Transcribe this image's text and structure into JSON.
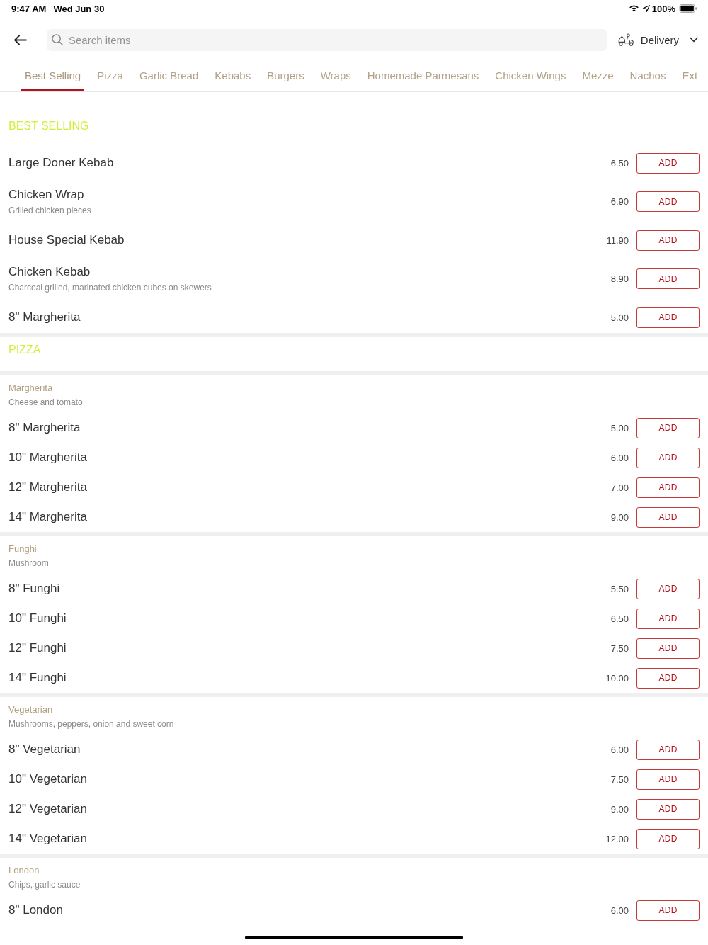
{
  "status_bar": {
    "time": "9:47 AM",
    "date": "Wed Jun 30",
    "battery": "100%"
  },
  "header": {
    "search": {
      "placeholder": "Search items"
    },
    "order_mode": {
      "label": "Delivery"
    }
  },
  "tabs": [
    {
      "label": "Best Selling",
      "selected": true
    },
    {
      "label": "Pizza",
      "selected": false
    },
    {
      "label": "Garlic Bread",
      "selected": false
    },
    {
      "label": "Kebabs",
      "selected": false
    },
    {
      "label": "Burgers",
      "selected": false
    },
    {
      "label": "Wraps",
      "selected": false
    },
    {
      "label": "Homemade Parmesans",
      "selected": false
    },
    {
      "label": "Chicken Wings",
      "selected": false
    },
    {
      "label": "Mezze",
      "selected": false
    },
    {
      "label": "Nachos",
      "selected": false
    },
    {
      "label": "Ext",
      "selected": false
    }
  ],
  "sections": [
    {
      "title": "BEST SELLING",
      "groups": [
        {
          "items": [
            {
              "name": "Large Doner Kebab",
              "price": "6.50",
              "button": "ADD"
            },
            {
              "name": "Chicken Wrap",
              "description": "Grilled chicken pieces",
              "price": "6.90",
              "button": "ADD"
            },
            {
              "name": "House Special Kebab",
              "price": "11.90",
              "button": "ADD"
            },
            {
              "name": "Chicken Kebab",
              "description": "Charcoal grilled, marinated chicken cubes on skewers",
              "price": "8.90",
              "button": "ADD"
            },
            {
              "name": "8\" Margherita",
              "price": "5.00",
              "button": "ADD"
            }
          ]
        }
      ]
    },
    {
      "title": "PIZZA",
      "groups": [
        {
          "name": "Margherita",
          "description": "Cheese and tomato",
          "items": [
            {
              "name": "8\" Margherita",
              "price": "5.00",
              "button": "ADD"
            },
            {
              "name": "10\" Margherita",
              "price": "6.00",
              "button": "ADD"
            },
            {
              "name": "12\" Margherita",
              "price": "7.00",
              "button": "ADD"
            },
            {
              "name": "14\" Margherita",
              "price": "9.00",
              "button": "ADD"
            }
          ]
        },
        {
          "name": "Funghi",
          "description": "Mushroom",
          "items": [
            {
              "name": "8\" Funghi",
              "price": "5.50",
              "button": "ADD"
            },
            {
              "name": "10\" Funghi",
              "price": "6.50",
              "button": "ADD"
            },
            {
              "name": "12\" Funghi",
              "price": "7.50",
              "button": "ADD"
            },
            {
              "name": "14\" Funghi",
              "price": "10.00",
              "button": "ADD"
            }
          ]
        },
        {
          "name": "Vegetarian",
          "description": "Mushrooms, peppers, onion and sweet corn",
          "items": [
            {
              "name": "8\" Vegetarian",
              "price": "6.00",
              "button": "ADD"
            },
            {
              "name": "10\" Vegetarian",
              "price": "7.50",
              "button": "ADD"
            },
            {
              "name": "12\" Vegetarian",
              "price": "9.00",
              "button": "ADD"
            },
            {
              "name": "14\" Vegetarian",
              "price": "12.00",
              "button": "ADD"
            }
          ]
        },
        {
          "name": "London",
          "description": "Chips, garlic sauce",
          "items": [
            {
              "name": "8\" London",
              "price": "6.00",
              "button": "ADD"
            }
          ]
        }
      ]
    }
  ]
}
